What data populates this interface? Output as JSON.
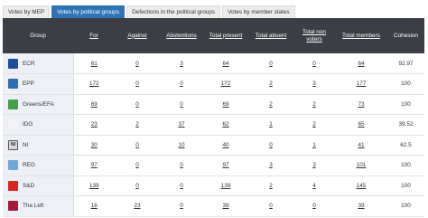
{
  "tabs": [
    {
      "label": "Votes by MEP",
      "active": false
    },
    {
      "label": "Votes by political groups",
      "active": true
    },
    {
      "label": "Defections in the political groups",
      "active": false
    },
    {
      "label": "Votes by member states",
      "active": false
    }
  ],
  "table": {
    "headers": {
      "group": "Group",
      "for": "For",
      "against": "Against",
      "abstentions": "Abstentions",
      "total_present": "Total present",
      "total_absent": "Total absent",
      "total_non_voters": "Total non voters",
      "total_members": "Total members",
      "cohesion": "Cohesion"
    },
    "rows": [
      {
        "group": "ECR",
        "logo_color": "#1b4f9c",
        "logo_text": "",
        "for": "61",
        "against": "0",
        "abstentions": "3",
        "total_present": "64",
        "total_absent": "0",
        "total_non_voters": "0",
        "total_members": "64",
        "cohesion": "92.97"
      },
      {
        "group": "EPP",
        "logo_color": "#2f6db5",
        "logo_text": "",
        "for": "172",
        "against": "0",
        "abstentions": "0",
        "total_present": "172",
        "total_absent": "2",
        "total_non_voters": "3",
        "total_members": "177",
        "cohesion": "100"
      },
      {
        "group": "Greens/EFA",
        "logo_color": "#43a047",
        "logo_text": "",
        "for": "69",
        "against": "0",
        "abstentions": "0",
        "total_present": "69",
        "total_absent": "2",
        "total_non_voters": "2",
        "total_members": "73",
        "cohesion": "100"
      },
      {
        "group": "IDG",
        "logo_color": "#f4f4f4",
        "logo_text": "",
        "for": "23",
        "against": "2",
        "abstentions": "37",
        "total_present": "62",
        "total_absent": "1",
        "total_non_voters": "2",
        "total_members": "65",
        "cohesion": "39.52"
      },
      {
        "group": "NI",
        "logo_color": "#d9d9d9",
        "logo_text": "NI",
        "for": "30",
        "against": "0",
        "abstentions": "10",
        "total_present": "40",
        "total_absent": "0",
        "total_non_voters": "1",
        "total_members": "41",
        "cohesion": "62.5"
      },
      {
        "group": "REG",
        "logo_color": "#6fa8dc",
        "logo_text": "",
        "for": "97",
        "against": "0",
        "abstentions": "0",
        "total_present": "97",
        "total_absent": "3",
        "total_non_voters": "3",
        "total_members": "101",
        "cohesion": "100"
      },
      {
        "group": "S&D",
        "logo_color": "#d7261e",
        "logo_text": "",
        "for": "139",
        "against": "0",
        "abstentions": "0",
        "total_present": "139",
        "total_absent": "2",
        "total_non_voters": "4",
        "total_members": "145",
        "cohesion": "100"
      },
      {
        "group": "The Left",
        "logo_color": "#a11c3a",
        "logo_text": "",
        "for": "16",
        "against": "23",
        "abstentions": "0",
        "total_present": "39",
        "total_absent": "0",
        "total_non_voters": "0",
        "total_members": "39",
        "cohesion": "100"
      }
    ]
  },
  "colors": {
    "active_tab": "#2d73b5",
    "header_bg": "#3b3f45",
    "group_cell_bg": "#edf1f7"
  }
}
